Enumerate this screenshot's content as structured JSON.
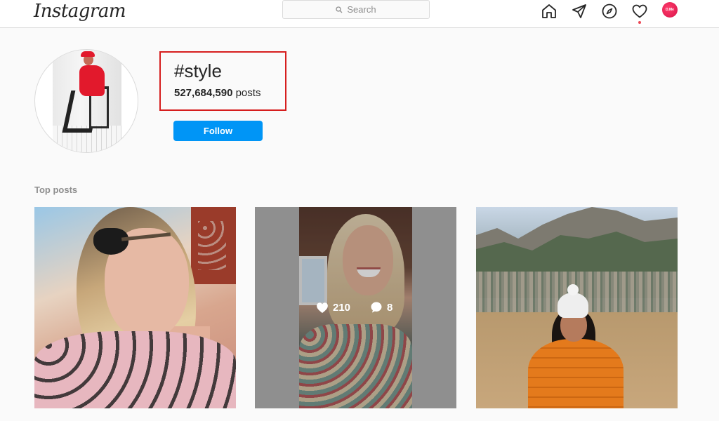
{
  "topbar": {
    "logo": "Instagram",
    "search_placeholder": "Search",
    "icons": [
      "home-icon",
      "direct-icon",
      "explore-icon",
      "activity-icon",
      "profile-avatar"
    ],
    "avatar_text": "D.Me"
  },
  "header": {
    "hashtag": "#style",
    "post_count_number": "527,684,590",
    "post_count_label": "posts",
    "follow_label": "Follow"
  },
  "sections": {
    "top_posts_label": "Top posts"
  },
  "posts": [
    {
      "id": 1
    },
    {
      "id": 2,
      "likes": "210",
      "comments": "8"
    },
    {
      "id": 3
    }
  ],
  "colors": {
    "accent": "#0095f6",
    "highlight_box": "#d61e1e",
    "notification_dot": "#ed4956"
  }
}
